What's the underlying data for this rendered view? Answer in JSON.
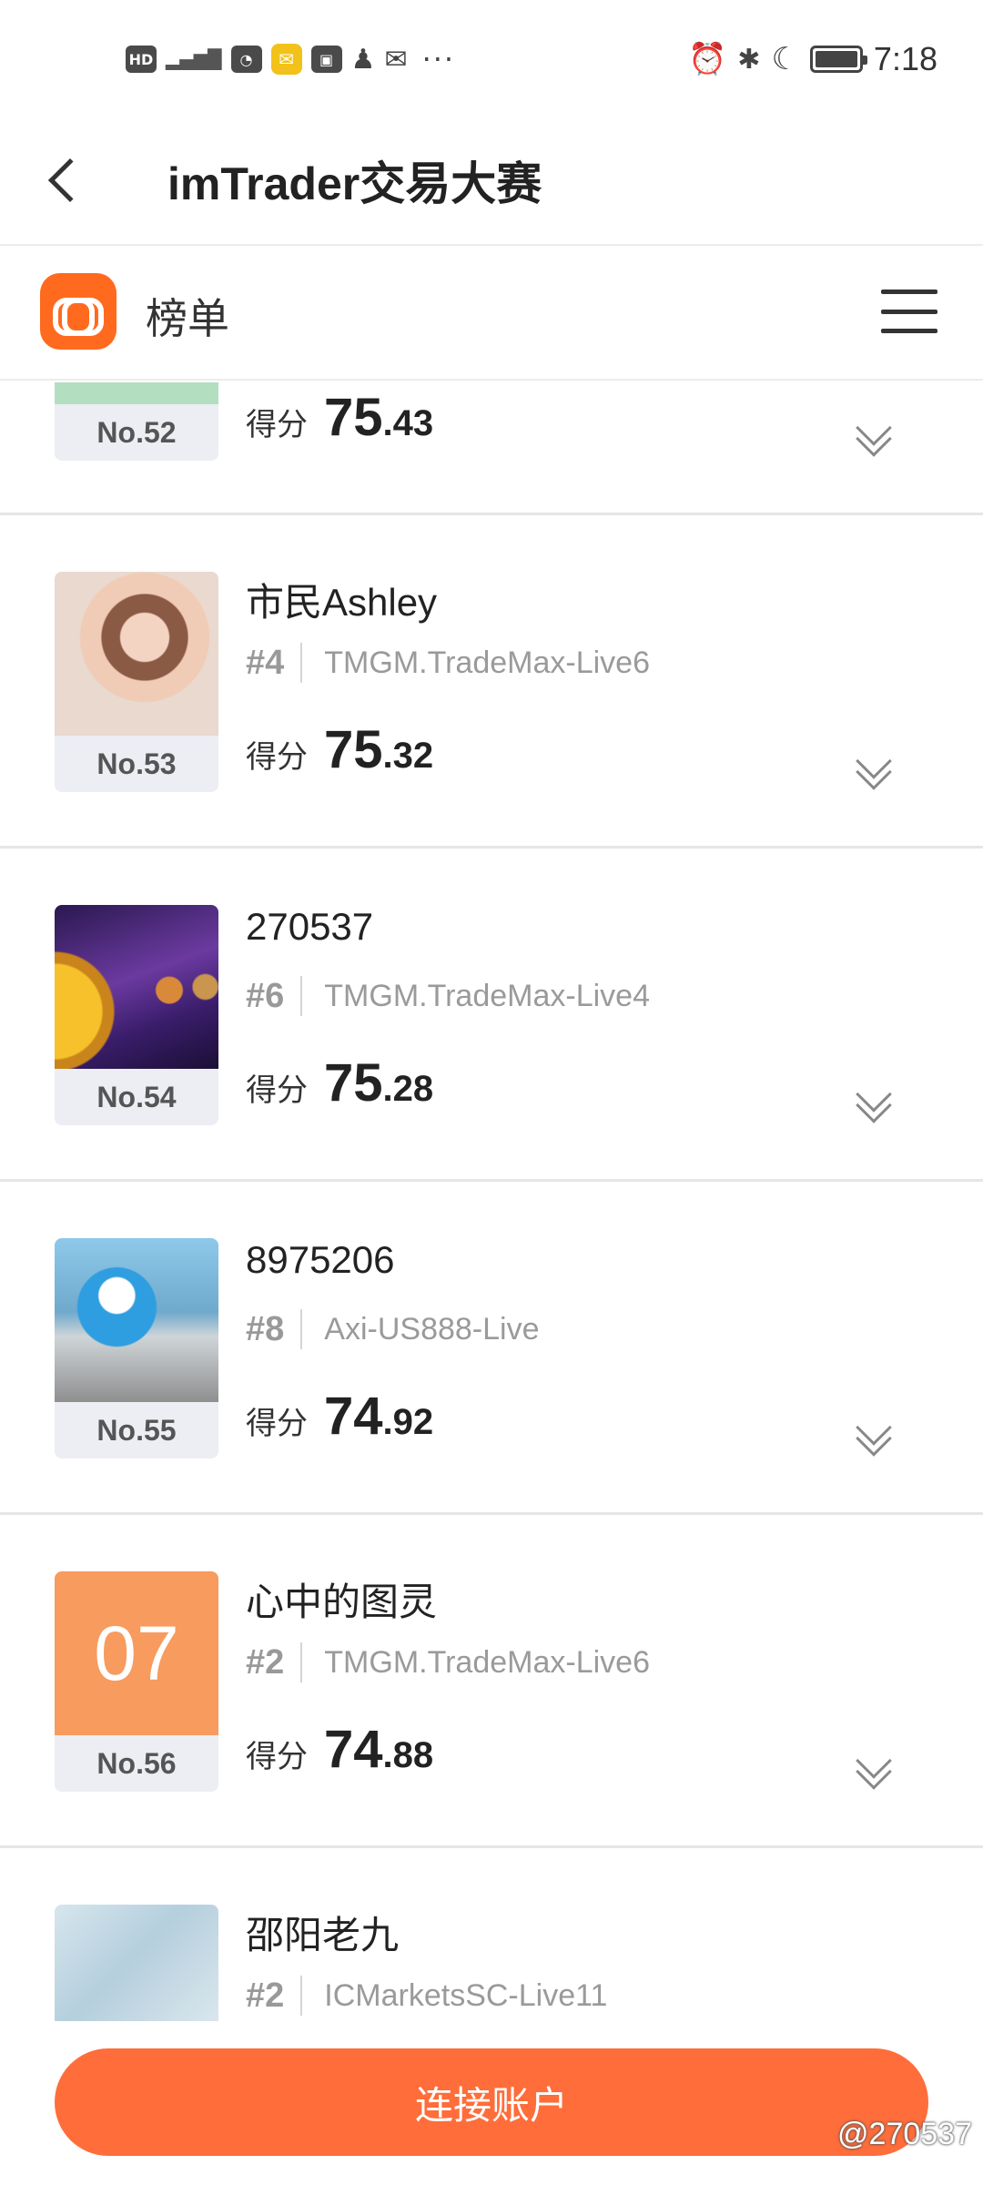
{
  "status_bar": {
    "left_icons": [
      "HD",
      "5G",
      "signal",
      "gallery",
      "mail-yellow",
      "huawei",
      "qq",
      "envelope"
    ],
    "more": "···",
    "time": "7:18"
  },
  "title_bar": {
    "title": "imTrader交易大赛"
  },
  "header": {
    "title": "榜单"
  },
  "score_label": "得分",
  "entries": [
    {
      "rank_label": "No.52",
      "name": "",
      "meta_rank": "",
      "server": "",
      "score_int": "75",
      "score_dec": ".43",
      "avatar": "green"
    },
    {
      "rank_label": "No.53",
      "name": "市民Ashley",
      "meta_rank": "#4",
      "server": "TMGM.TradeMax-Live6",
      "score_int": "75",
      "score_dec": ".32",
      "avatar": "photo"
    },
    {
      "rank_label": "No.54",
      "name": "270537",
      "meta_rank": "#6",
      "server": "TMGM.TradeMax-Live4",
      "score_int": "75",
      "score_dec": ".28",
      "avatar": "space"
    },
    {
      "rank_label": "No.55",
      "name": "8975206",
      "meta_rank": "#8",
      "server": "Axi-US888-Live",
      "score_int": "74",
      "score_dec": ".92",
      "avatar": "doraemon"
    },
    {
      "rank_label": "No.56",
      "name": "心中的图灵",
      "meta_rank": "#2",
      "server": "TMGM.TradeMax-Live6",
      "score_int": "74",
      "score_dec": ".88",
      "avatar": "07",
      "avatar_text": "07"
    },
    {
      "rank_label": "",
      "name": "邵阳老九",
      "meta_rank": "#2",
      "server": "ICMarketsSC-Live11",
      "score_int": "",
      "score_dec": "",
      "avatar": "stairs"
    }
  ],
  "connect_button": "连接账户",
  "watermark": "@270537",
  "colors": {
    "accent": "#ff6d3a",
    "logo": "#ff6a1f"
  }
}
